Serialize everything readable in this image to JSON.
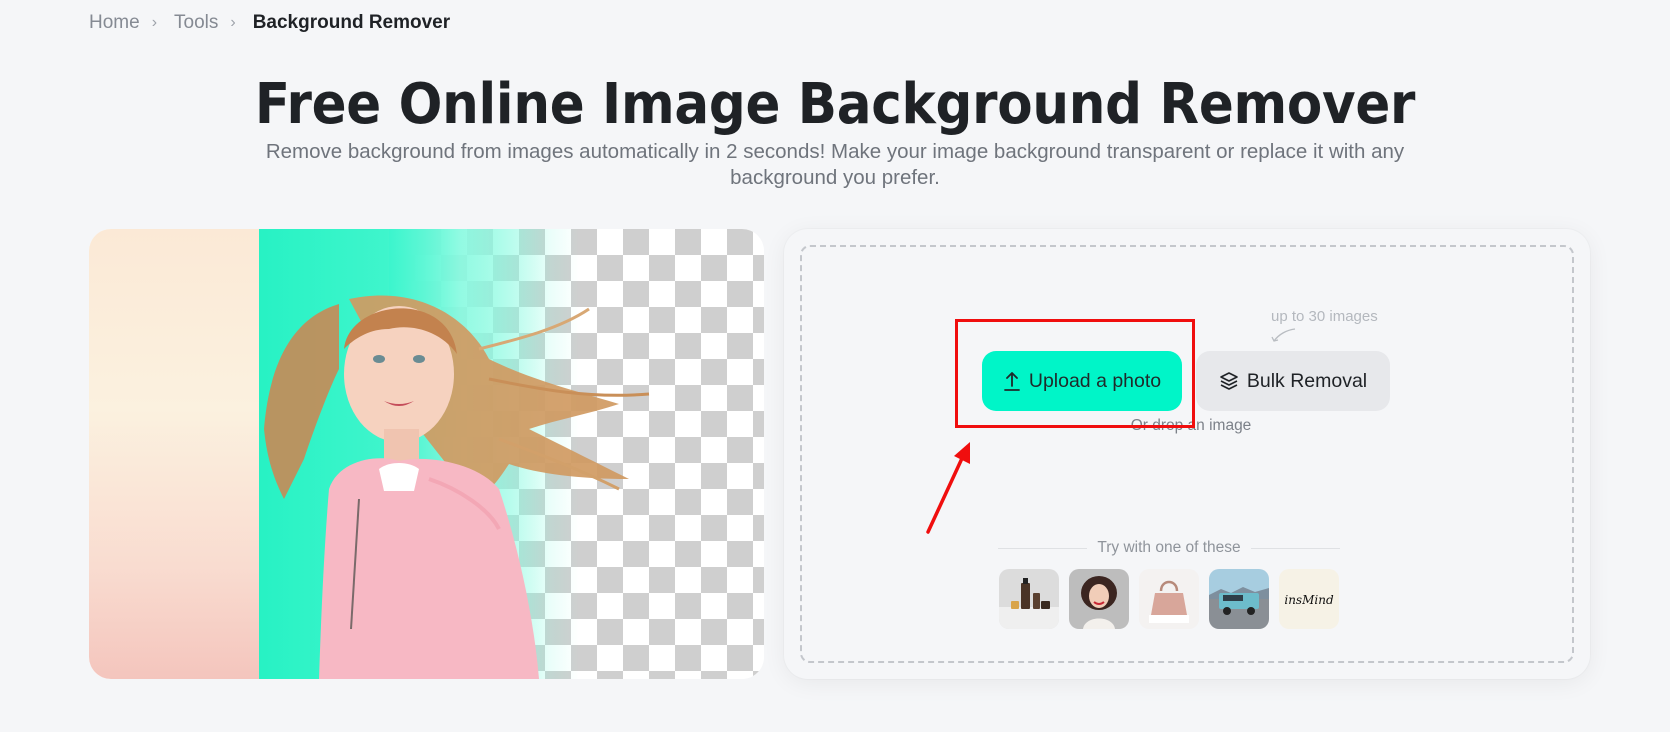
{
  "breadcrumb": {
    "items": [
      {
        "label": "Home"
      },
      {
        "label": "Tools"
      }
    ],
    "separator": "›",
    "current": "Background Remover"
  },
  "hero": {
    "title": "Free Online Image Background Remover",
    "subtitle": "Remove background from images automatically in 2 seconds! Make your image background transparent or replace it with any background you prefer."
  },
  "showcase": {
    "alt": "Girl with flying hair, background partially removed showing transparency checkerboard",
    "colors": {
      "mint": "#27f2c4",
      "warm": "#fbe9d6"
    }
  },
  "upload": {
    "upload_button_label": "Upload a photo",
    "upload_icon": "upload-arrow-icon",
    "bulk_button_label": "Bulk Removal",
    "bulk_icon": "layers-icon",
    "bulk_hint": "up to 30 images",
    "drop_text": "Or drop an image",
    "accent_color": "#00f5c8"
  },
  "samples": {
    "label": "Try with one of these",
    "items": [
      {
        "name": "cosmetics-bottles"
      },
      {
        "name": "smiling-woman"
      },
      {
        "name": "handbag"
      },
      {
        "name": "blue-suv"
      },
      {
        "name": "insmind-logo",
        "text": "insMind"
      }
    ]
  },
  "annotation": {
    "highlight_color": "#f00e0e"
  }
}
